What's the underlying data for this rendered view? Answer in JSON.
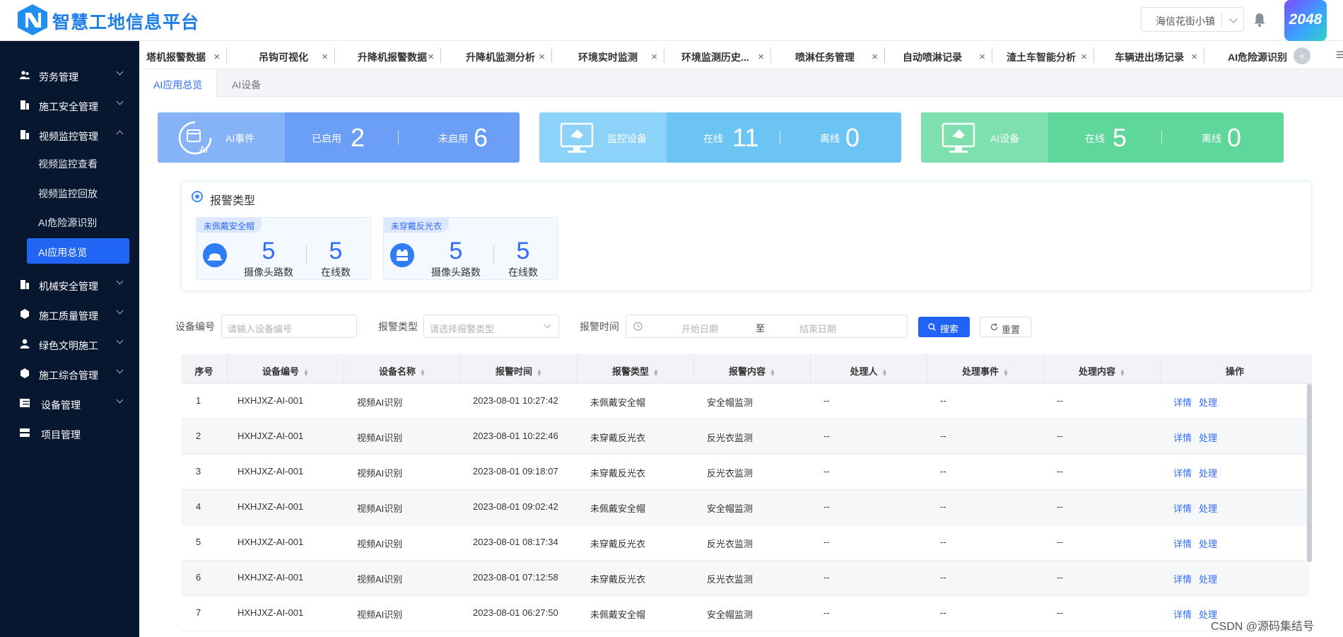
{
  "header": {
    "app_title": "智慧工地信息平台",
    "project_select": "海信花街小镇",
    "badge": "2048"
  },
  "sidebar": {
    "items": [
      {
        "label": "劳务管理",
        "icon": "people-icon"
      },
      {
        "label": "施工安全管理",
        "icon": "building-icon"
      },
      {
        "label": "视频监控管理",
        "icon": "building-icon",
        "expanded": true
      },
      {
        "label": "机械安全管理",
        "icon": "building-icon"
      },
      {
        "label": "施工质量管理",
        "icon": "cube-icon"
      },
      {
        "label": "绿色文明施工",
        "icon": "person-icon"
      },
      {
        "label": "施工综合管理",
        "icon": "cube-icon"
      },
      {
        "label": "设备管理",
        "icon": "table-icon"
      },
      {
        "label": "项目管理",
        "icon": "server-icon"
      }
    ],
    "sub_items": [
      "视频监控查看",
      "视频监控回放",
      "AI危险源识别",
      "AI应用总览"
    ],
    "active_sub": "AI应用总览"
  },
  "tabs": [
    "塔机报警数据",
    "吊钩可视化",
    "升降机报警数据",
    "升降机监测分析",
    "环境实时监测",
    "环境监测历史...",
    "喷淋任务管理",
    "自动喷淋记录",
    "渣土车智能分析",
    "车辆进出场记录",
    "AI危险源识别"
  ],
  "subtabs": {
    "active": "AI应用总览",
    "other": "AI设备"
  },
  "stat_cards": [
    {
      "title": "AI事件",
      "a_label": "已启用",
      "a_value": "2",
      "b_label": "未启用",
      "b_value": "6",
      "color": "#6b9ff6"
    },
    {
      "title": "监控设备",
      "a_label": "在线",
      "a_value": "11",
      "b_label": "离线",
      "b_value": "0",
      "color": "#6cc4f5"
    },
    {
      "title": "AI设备",
      "a_label": "在线",
      "a_value": "5",
      "b_label": "离线",
      "b_value": "0",
      "color": "#5fd69a"
    }
  ],
  "alarm_panel": {
    "title": "报警类型",
    "cards": [
      {
        "tag": "未佩戴安全帽",
        "cameras": "5",
        "cameras_label": "摄像头路数",
        "online": "5",
        "online_label": "在线数"
      },
      {
        "tag": "未穿戴反光衣",
        "cameras": "5",
        "cameras_label": "摄像头路数",
        "online": "5",
        "online_label": "在线数"
      }
    ]
  },
  "filters": {
    "device_no_label": "设备编号",
    "device_no_placeholder": "请输入设备编号",
    "alarm_type_label": "报警类型",
    "alarm_type_placeholder": "请选择报警类型",
    "alarm_time_label": "报警时间",
    "start_placeholder": "开始日期",
    "to": "至",
    "end_placeholder": "结束日期",
    "search": "搜索",
    "reset": "重置"
  },
  "table": {
    "headers": [
      "序号",
      "设备编号",
      "设备名称",
      "报警时间",
      "报警类型",
      "报警内容",
      "处理人",
      "处理事件",
      "处理内容",
      "操作"
    ],
    "detail": "详情",
    "handle": "处理",
    "rows": [
      [
        "1",
        "HXHJXZ-AI-001",
        "视频AI识别",
        "2023-08-01 10:27:42",
        "未佩戴安全帽",
        "安全帽监测",
        "--",
        "--",
        "--"
      ],
      [
        "2",
        "HXHJXZ-AI-001",
        "视频AI识别",
        "2023-08-01 10:22:46",
        "未穿戴反光衣",
        "反光衣监测",
        "--",
        "--",
        "--"
      ],
      [
        "3",
        "HXHJXZ-AI-001",
        "视频AI识别",
        "2023-08-01 09:18:07",
        "未穿戴反光衣",
        "反光衣监测",
        "--",
        "--",
        "--"
      ],
      [
        "4",
        "HXHJXZ-AI-001",
        "视频AI识别",
        "2023-08-01 09:02:42",
        "未佩戴安全帽",
        "安全帽监测",
        "--",
        "--",
        "--"
      ],
      [
        "5",
        "HXHJXZ-AI-001",
        "视频AI识别",
        "2023-08-01 08:17:34",
        "未穿戴反光衣",
        "反光衣监测",
        "--",
        "--",
        "--"
      ],
      [
        "6",
        "HXHJXZ-AI-001",
        "视频AI识别",
        "2023-08-01 07:12:58",
        "未穿戴反光衣",
        "反光衣监测",
        "--",
        "--",
        "--"
      ],
      [
        "7",
        "HXHJXZ-AI-001",
        "视频AI识别",
        "2023-08-01 06:27:50",
        "未佩戴安全帽",
        "安全帽监测",
        "--",
        "--",
        "--"
      ]
    ]
  },
  "watermark": "CSDN @源码集结号"
}
